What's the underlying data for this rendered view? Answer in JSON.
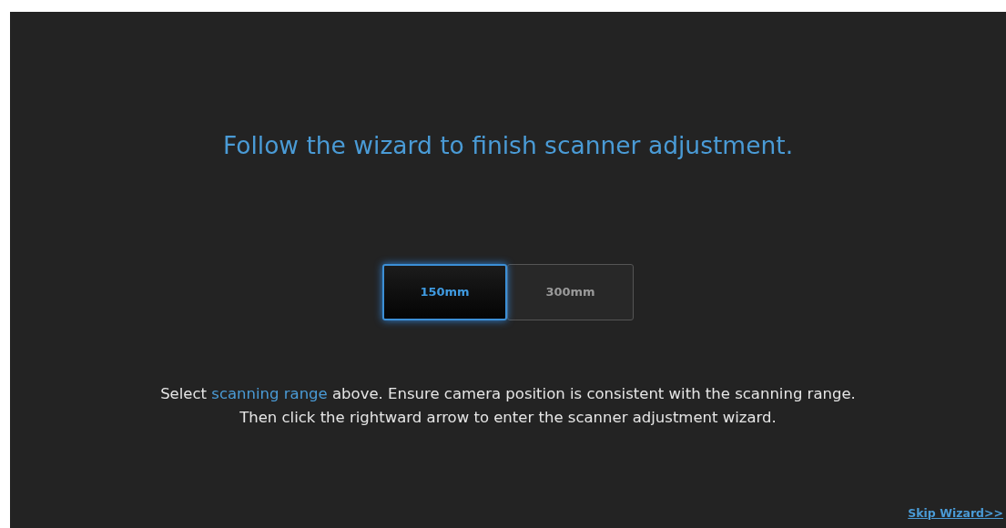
{
  "title": "Follow the wizard to finish scanner adjustment.",
  "range_options": [
    {
      "label": "150mm",
      "selected": true
    },
    {
      "label": "300mm",
      "selected": false
    }
  ],
  "instructions": [
    [
      {
        "text": "Select ",
        "highlight": false
      },
      {
        "text": "scanning range",
        "highlight": true
      },
      {
        "text": " above. Ensure camera position is consistent with the scanning range.",
        "highlight": false
      }
    ],
    [
      {
        "text": "Then click the rightward arrow to enter the scanner adjustment wizard.",
        "highlight": false
      }
    ]
  ],
  "skip_link": "Skip Wizard>>"
}
